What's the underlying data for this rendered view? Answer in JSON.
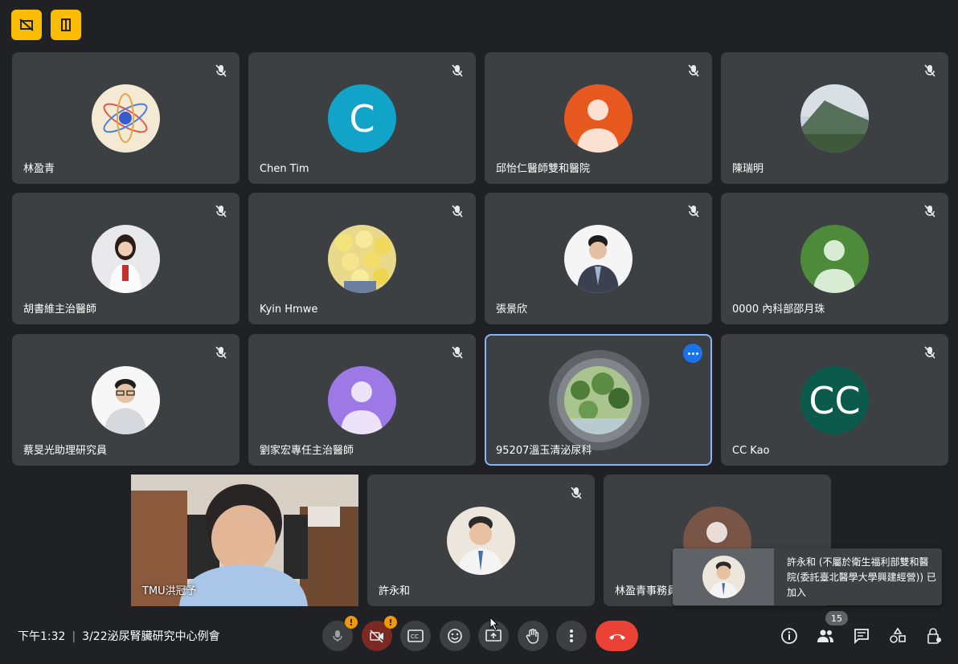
{
  "participants": [
    {
      "name": "林盈青",
      "avatar": "atom-photo"
    },
    {
      "name": "Chen Tim",
      "avatar": "letter",
      "letter": "C",
      "color": "#12a4c8"
    },
    {
      "name": "邱怡仁醫師雙和醫院",
      "avatar": "default-person",
      "color": "#e8591f"
    },
    {
      "name": "陳瑞明",
      "avatar": "mountain-photo"
    },
    {
      "name": "胡書維主治醫師",
      "avatar": "doctor-photo"
    },
    {
      "name": "Kyin Hmwe",
      "avatar": "roses-photo"
    },
    {
      "name": "張景欣",
      "avatar": "suit-photo"
    },
    {
      "name": "0000 內科部邵月珠",
      "avatar": "default-person",
      "color": "#4d8a3a"
    },
    {
      "name": "蔡旻光助理研究員",
      "avatar": "glasses-photo"
    },
    {
      "name": "劉家宏專任主治醫師",
      "avatar": "default-person",
      "color": "#9c79e6"
    },
    {
      "name": "95207溫玉清泌尿科",
      "avatar": "lotus-photo"
    },
    {
      "name": "CC Kao",
      "avatar": "letter",
      "letter": "CC",
      "color": "#0b5a4b"
    },
    {
      "name": "TMU洪冠予",
      "avatar": "video"
    },
    {
      "name": "許永和",
      "avatar": "man-photo"
    },
    {
      "name": "林盈青事務員",
      "avatar": "default-person",
      "color": "#795548"
    }
  ],
  "toast": {
    "message": "許永和 (不屬於衛生福利部雙和醫院(委託臺北醫學大學興建經營)) 已加入"
  },
  "meeting": {
    "time": "下午1:32",
    "title": "3/22泌尿腎臟研究中心例會"
  },
  "controls": {
    "people_count": "15",
    "mic_warning": "!",
    "cam_warning": "!"
  },
  "colors": {
    "background": "#202124",
    "tile": "#3c4043",
    "accent_warning": "#fbbc04",
    "end_call": "#ea4335",
    "active_speaker": "#8ab4f8"
  }
}
